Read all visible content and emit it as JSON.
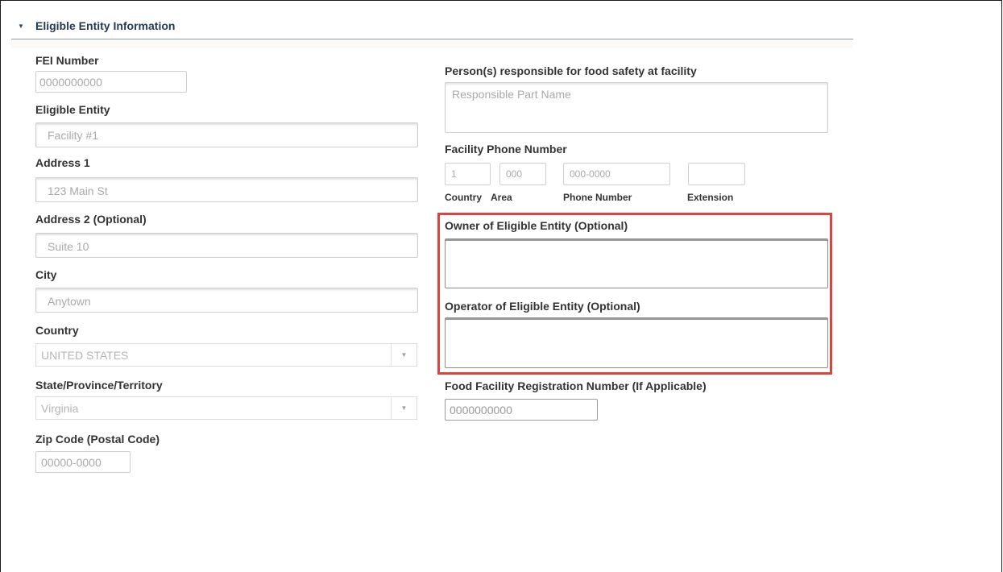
{
  "section": {
    "title": "Eligible Entity Information"
  },
  "left": {
    "fei_number": {
      "label": "FEI Number",
      "value": "0000000000"
    },
    "eligible_entity": {
      "label": "Eligible Entity",
      "value": "Facility #1"
    },
    "address1": {
      "label": "Address 1",
      "value": "123 Main St"
    },
    "address2": {
      "label": "Address 2 (Optional)",
      "value": "Suite 10"
    },
    "city": {
      "label": "City",
      "value": "Anytown"
    },
    "country": {
      "label": "Country",
      "value": "UNITED STATES"
    },
    "state": {
      "label": "State/Province/Territory",
      "value": "Virginia"
    },
    "zip": {
      "label": "Zip Code (Postal Code)",
      "value": "00000-0000"
    }
  },
  "right": {
    "responsible": {
      "label": "Person(s) responsible for food safety at facility",
      "placeholder": "Responsible Part Name"
    },
    "phone": {
      "label": "Facility Phone Number",
      "country_value": "1",
      "area_value": "000",
      "number_value": "000-0000",
      "extension_value": "",
      "country_label": "Country",
      "area_label": "Area",
      "number_label": "Phone Number",
      "extension_label": "Extension"
    },
    "owner": {
      "label": "Owner of Eligible Entity (Optional)",
      "value": ""
    },
    "operator": {
      "label": "Operator of Eligible Entity (Optional)",
      "value": ""
    },
    "ffr_number": {
      "label": "Food Facility Registration Number (If Applicable)",
      "value": "0000000000"
    }
  },
  "colors": {
    "highlight": "#d9463f",
    "header_text": "#1f3b54"
  }
}
